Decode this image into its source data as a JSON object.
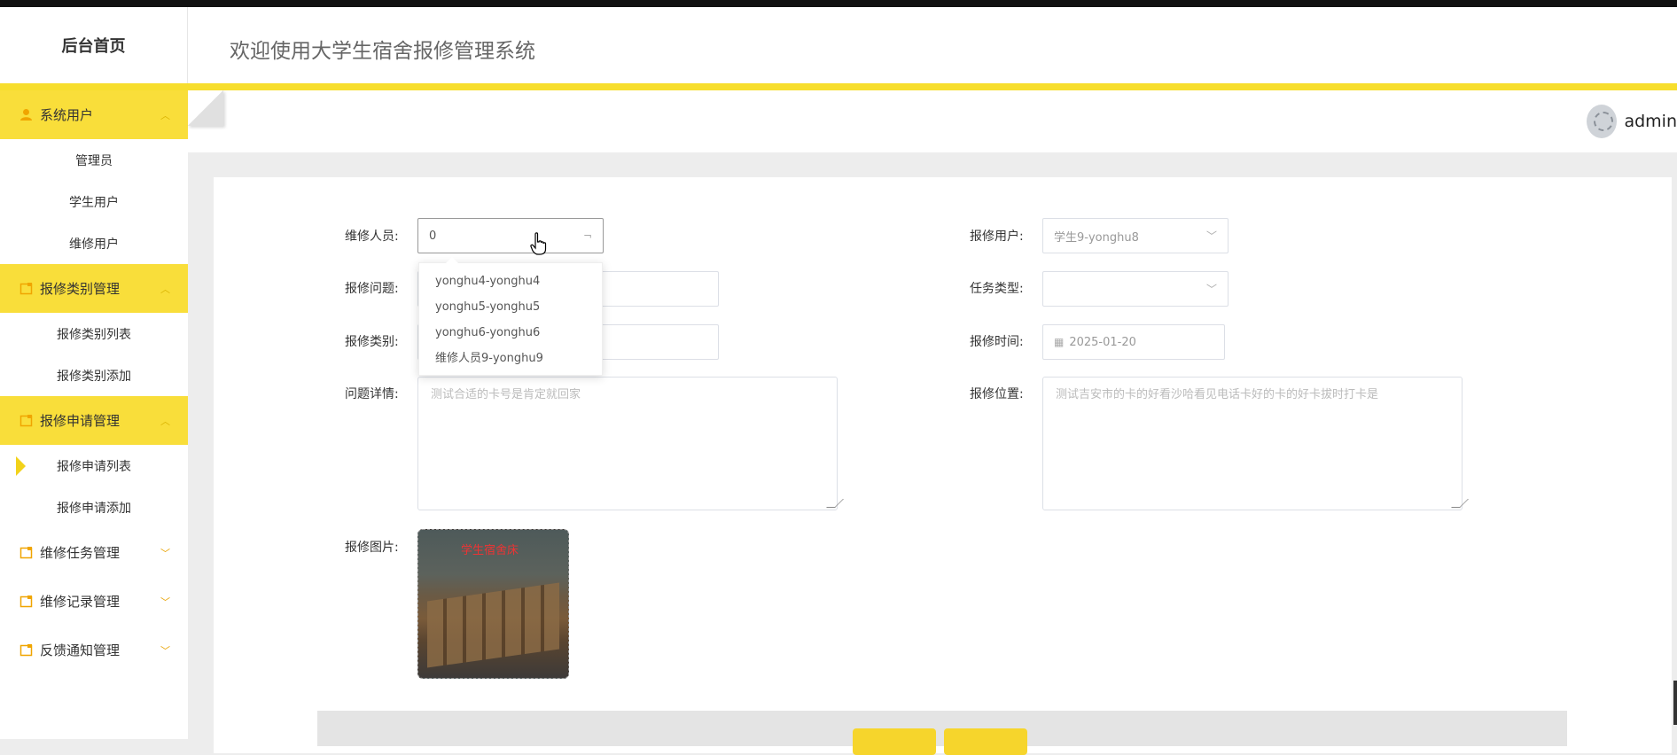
{
  "header": {
    "brand": "后台首页",
    "title": "欢迎使用大学生宿舍报修管理系统"
  },
  "user": {
    "name": "admin"
  },
  "sidebar": {
    "groups": [
      {
        "label": "系统用户",
        "icon": "user-icon",
        "expanded": true,
        "items": [
          "管理员",
          "学生用户",
          "维修用户"
        ]
      },
      {
        "label": "报修类别管理",
        "icon": "folder-icon",
        "expanded": true,
        "items": [
          "报修类别列表",
          "报修类别添加"
        ]
      },
      {
        "label": "报修申请管理",
        "icon": "folder-icon",
        "expanded": true,
        "items": [
          "报修申请列表",
          "报修申请添加"
        ],
        "active_item": "报修申请列表"
      },
      {
        "label": "维修任务管理",
        "icon": "folder-icon",
        "expanded": false
      },
      {
        "label": "维修记录管理",
        "icon": "folder-icon",
        "expanded": false
      },
      {
        "label": "反馈通知管理",
        "icon": "folder-icon",
        "expanded": false
      }
    ]
  },
  "form": {
    "repairer": {
      "label": "维修人员:",
      "value": "0"
    },
    "reporter": {
      "label": "报修用户:",
      "value": "学生9-yonghu8"
    },
    "issue": {
      "label": "报修问题:",
      "value": ""
    },
    "task_type": {
      "label": "任务类型:",
      "value": ""
    },
    "category": {
      "label": "报修类别:",
      "value": ""
    },
    "report_time": {
      "label": "报修时间:",
      "value": "2025-01-20"
    },
    "details": {
      "label": "问题详情:",
      "placeholder": "测试合适的卡号是肯定就回家"
    },
    "location": {
      "label": "报修位置:",
      "placeholder": "测试吉安市的卡的好看沙哈看见电话卡好的卡的好卡拔时打卡是"
    },
    "image": {
      "label": "报修图片:",
      "caption": "学生宿舍床"
    }
  },
  "dropdown": {
    "options": [
      "yonghu4-yonghu4",
      "yonghu5-yonghu5",
      "yonghu6-yonghu6",
      "维修人员9-yonghu9"
    ]
  },
  "colors": {
    "accent": "#f7de2d",
    "menu_open": "#f9de3a"
  }
}
